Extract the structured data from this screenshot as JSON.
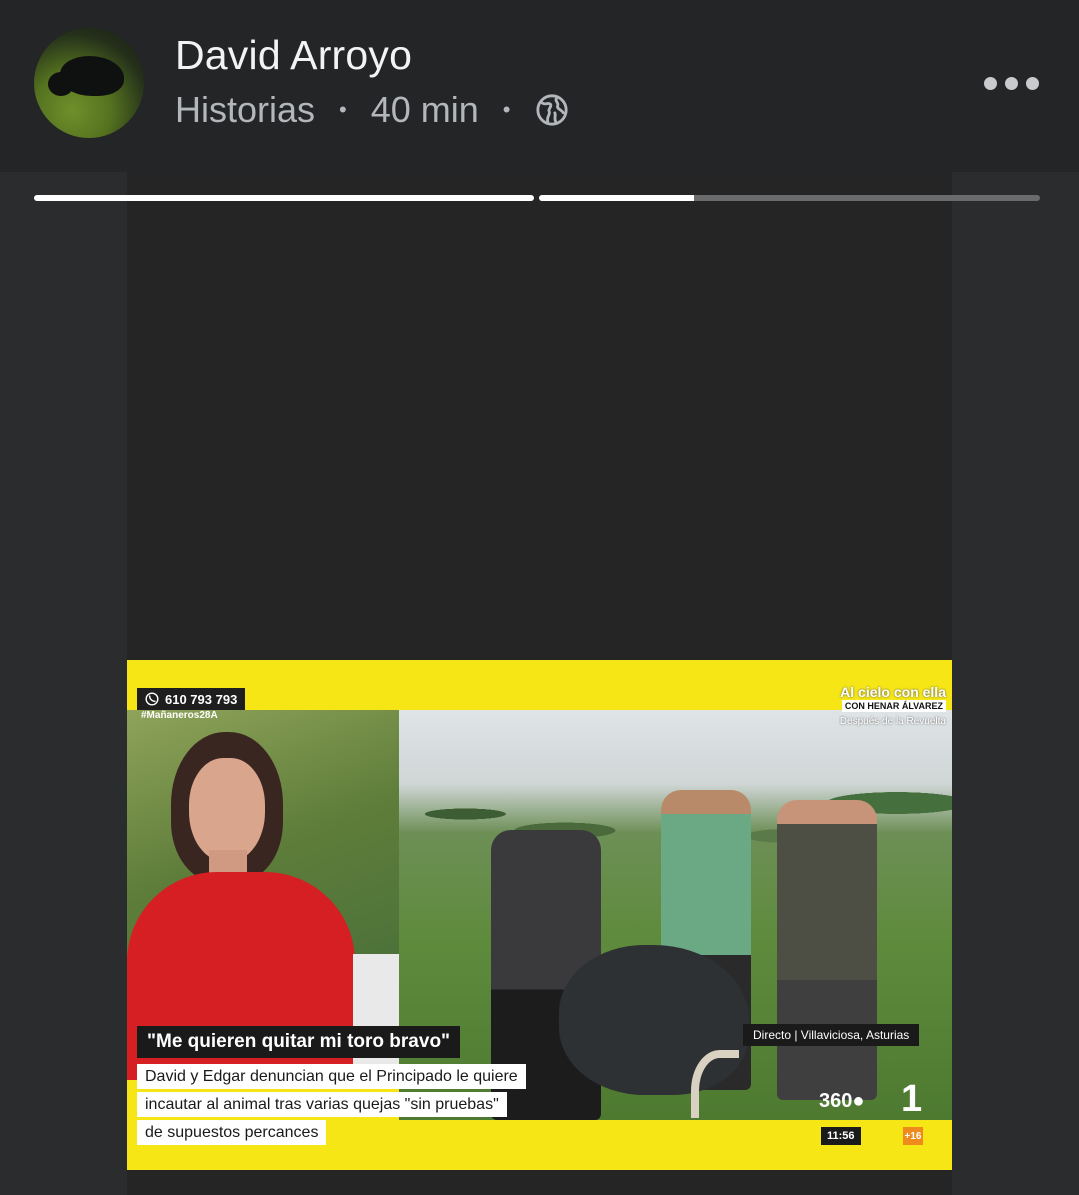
{
  "header": {
    "author_name": "David Arroyo",
    "source": "Historias",
    "separator": "•",
    "time_ago": "40 min",
    "visibility_icon": "globe-icon",
    "more_icon": "more-horizontal-icon"
  },
  "story": {
    "progress": [
      1.0,
      0.31
    ],
    "media": {
      "phone": "610 793 793",
      "hashtag": "#Mañaneros28A",
      "show_title": "Al cielo con ella",
      "show_host": "CON HENAR ÁLVAREZ",
      "show_sub": "Después de la Revuelta",
      "headline": "\"Me quieren quitar mi toro bravo\"",
      "location": "Directo  |  Villaviciosa, Asturias",
      "subtitle_lines": [
        "David y Edgar denuncian que el Principado le quiere",
        "incautar al animal tras varias quejas \"sin pruebas\"",
        "de supuestos percances"
      ],
      "channel_logo_a": "360",
      "channel_logo_b": "1",
      "clock": "11:56",
      "age_rating": "+16"
    }
  },
  "colors": {
    "header_bg": "#242527",
    "story_bg": "#252526",
    "tv_yellow": "#f6e616",
    "progress_fill": "#ffffff",
    "progress_track": "#6a6b6d"
  }
}
